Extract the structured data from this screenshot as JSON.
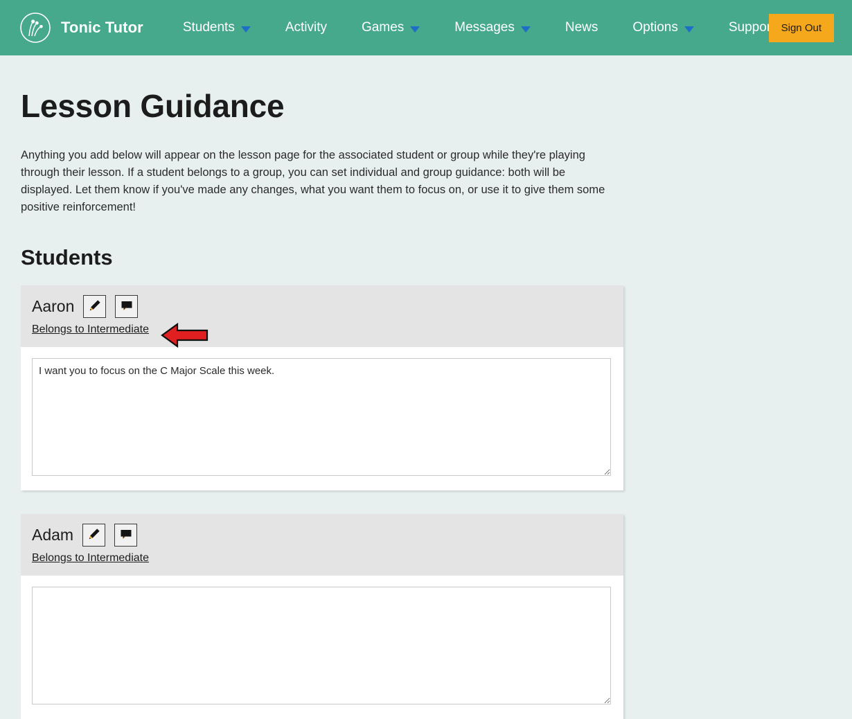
{
  "navbar": {
    "brand": "Tonic Tutor",
    "logo_icon": "tonic-tutor-circle-logo",
    "items": [
      {
        "label": "Students",
        "has_caret": true
      },
      {
        "label": "Activity",
        "has_caret": false
      },
      {
        "label": "Games",
        "has_caret": true
      },
      {
        "label": "Messages",
        "has_caret": true
      },
      {
        "label": "News",
        "has_caret": false
      },
      {
        "label": "Options",
        "has_caret": true
      },
      {
        "label": "Support",
        "has_caret": true
      }
    ],
    "sign_out_label": "Sign Out",
    "colors": {
      "background": "#46a98b",
      "text": "#ffffff",
      "caret": "#1c6fc4",
      "sign_out_background": "#f5a81c",
      "sign_out_text": "#1b1b1b"
    }
  },
  "page": {
    "title": "Lesson Guidance",
    "intro": "Anything you add below will appear on the lesson page for the associated student or group while they're playing through their lesson. If a student belongs to a group, you can set individual and group guidance: both will be displayed. Let them know if you've made any changes, what you want them to focus on, or use it to give them some positive reinforcement!",
    "section_title": "Students",
    "background_color": "#e8f0ef"
  },
  "students": [
    {
      "name": "Aaron",
      "edit_icon": "pencil-icon",
      "message_icon": "speech-bubble-icon",
      "group_link": "Belongs to Intermediate",
      "guidance_text": "I want you to focus on the C Major Scale this week.",
      "guidance_placeholder": "",
      "annotation": {
        "type": "arrow-left",
        "color": "#e02020"
      }
    },
    {
      "name": "Adam",
      "edit_icon": "pencil-icon",
      "message_icon": "speech-bubble-icon",
      "group_link": "Belongs to Intermediate",
      "guidance_text": "",
      "guidance_placeholder": "",
      "annotation": null
    }
  ]
}
